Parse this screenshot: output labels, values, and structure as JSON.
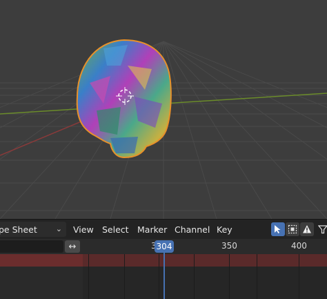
{
  "viewport": {
    "selection_outline_color": "#e8912a",
    "x_axis_color": "#8a3a3a",
    "y_axis_color": "#6b8c2a",
    "cursor": "3d-cursor-icon"
  },
  "editor_header": {
    "editor_type": "pe Sheet",
    "menus": [
      "View",
      "Select",
      "Marker",
      "Channel",
      "Key"
    ],
    "tools": [
      "select-arrow-icon",
      "box-select-icon",
      "warning-icon",
      "filter-icon"
    ]
  },
  "timeline": {
    "current_frame": "304",
    "partial_tick": "3",
    "ticks": [
      "350",
      "400"
    ],
    "swap_icon": "↔"
  },
  "colors": {
    "accent": "#4772b3",
    "channel_row": "#5a2a2a"
  }
}
